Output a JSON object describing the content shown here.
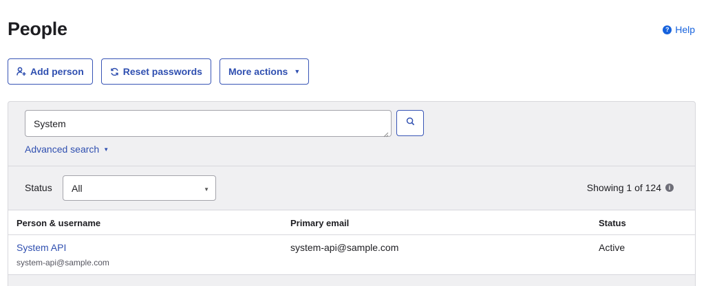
{
  "header": {
    "title": "People",
    "help_label": "Help"
  },
  "toolbar": {
    "add_person_label": "Add person",
    "reset_passwords_label": "Reset passwords",
    "more_actions_label": "More actions"
  },
  "search": {
    "value": "System",
    "advanced_label": "Advanced search"
  },
  "filters": {
    "status_label": "Status",
    "status_selected": "All",
    "showing_text": "Showing 1 of 124"
  },
  "table": {
    "columns": [
      "Person & username",
      "Primary email",
      "Status"
    ],
    "rows": [
      {
        "name": "System API",
        "username": "system-api@sample.com",
        "email": "system-api@sample.com",
        "status": "Active"
      }
    ]
  },
  "colors": {
    "accent": "#2f4fb0",
    "link": "#1662dd",
    "panel_bg": "#f0f0f2"
  },
  "icons": {
    "help": "help-circle-icon",
    "add_person": "add-person-icon",
    "reset": "refresh-icon",
    "more": "caret-down-icon",
    "search": "search-icon",
    "info": "info-icon"
  }
}
